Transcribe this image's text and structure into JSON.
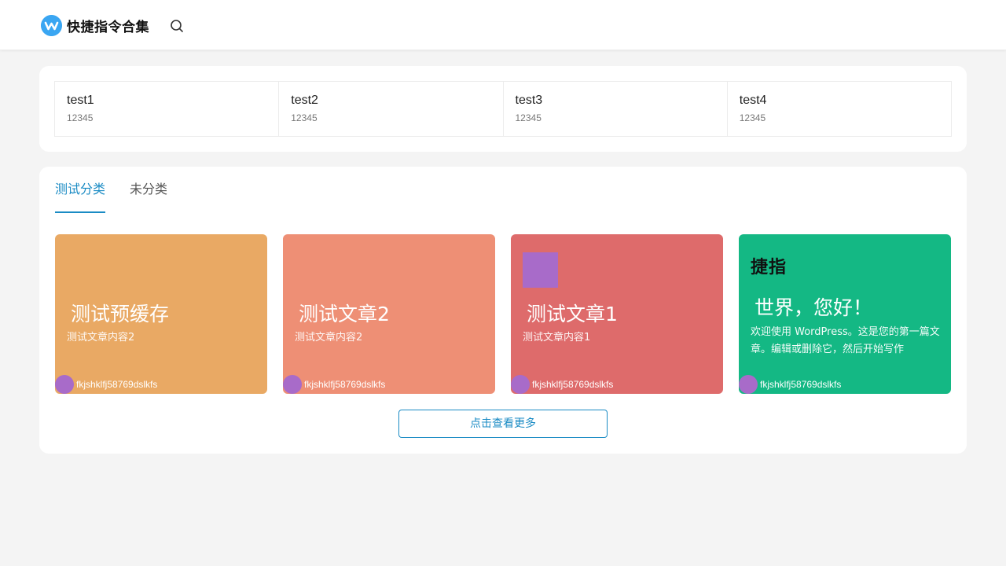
{
  "header": {
    "logo_text": "快捷指令合集",
    "logo_icon": "w-logo-icon",
    "search_icon": "search-icon"
  },
  "stats": [
    {
      "title": "test1",
      "value": "12345"
    },
    {
      "title": "test2",
      "value": "12345"
    },
    {
      "title": "test3",
      "value": "12345"
    },
    {
      "title": "test4",
      "value": "12345"
    }
  ],
  "tabs": [
    {
      "label": "测试分类",
      "active": true
    },
    {
      "label": "未分类",
      "active": false
    }
  ],
  "cards": [
    {
      "title": "测试预缓存",
      "desc": "测试文章内容2",
      "author": "fkjshklfj58769dslkfs",
      "color": "#e9a964"
    },
    {
      "title": "测试文章2",
      "desc": "测试文章内容2",
      "author": "fkjshklfj58769dslkfs",
      "color": "#ee8f75"
    },
    {
      "title": "测试文章1",
      "desc": "测试文章内容1",
      "author": "fkjshklfj58769dslkfs",
      "color": "#de6b6b",
      "thumb_color": "#a86bc9"
    },
    {
      "brand": "捷指",
      "title": "世界，您好！",
      "excerpt": "欢迎使用 WordPress。这是您的第一篇文章。编辑或删除它，然后开始写作",
      "author": "fkjshklfj58769dslkfs",
      "color": "#14b884"
    }
  ],
  "more_button": "点击查看更多",
  "colors": {
    "accent": "#1a8bc4",
    "avatar": "#a86bc9",
    "logo": "#3aa6f2"
  }
}
